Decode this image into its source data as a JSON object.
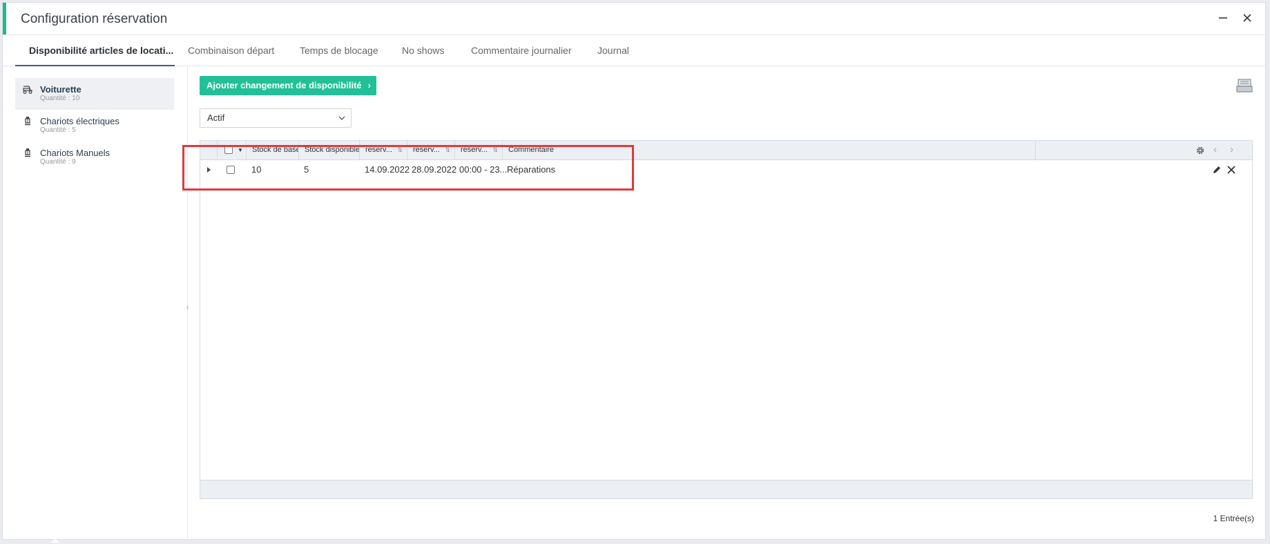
{
  "window": {
    "title": "Configuration réservation"
  },
  "tabs": [
    {
      "label": "Disponibilité articles de locati..."
    },
    {
      "label": "Combinaison départ"
    },
    {
      "label": "Temps de blocage"
    },
    {
      "label": "No shows"
    },
    {
      "label": "Commentaire journalier"
    },
    {
      "label": "Journal"
    }
  ],
  "sidebar": {
    "items": [
      {
        "name": "Voiturette",
        "qty": "Quantité : 10",
        "icon": "golf-cart-icon"
      },
      {
        "name": "Chariots électriques",
        "qty": "Quantité : 5",
        "icon": "trolley-icon"
      },
      {
        "name": "Chariots Manuels",
        "qty": "Quantité : 9",
        "icon": "trolley-icon"
      }
    ]
  },
  "toolbar": {
    "add_label": "Ajouter changement de disponibilité",
    "add_icon": "chevron-right-icon"
  },
  "filter": {
    "selected": "Actif"
  },
  "table": {
    "columns": [
      "Stock de base",
      "Stock disponible",
      "reserv...",
      "reserv...",
      "reserv...",
      "Commentaire"
    ],
    "rows": [
      {
        "stock_base": "10",
        "stock_dispo": "5",
        "start": "14.09.2022",
        "end": "28.09.2022",
        "time": "00:00 - 23...",
        "comment": "Réparations"
      }
    ]
  },
  "footer": {
    "entries": "1 Entrée(s)"
  },
  "colors": {
    "accent": "#22b88f",
    "button": "#22c097",
    "highlight": "#e0393e",
    "tab_underline": "#3c5a8a"
  }
}
